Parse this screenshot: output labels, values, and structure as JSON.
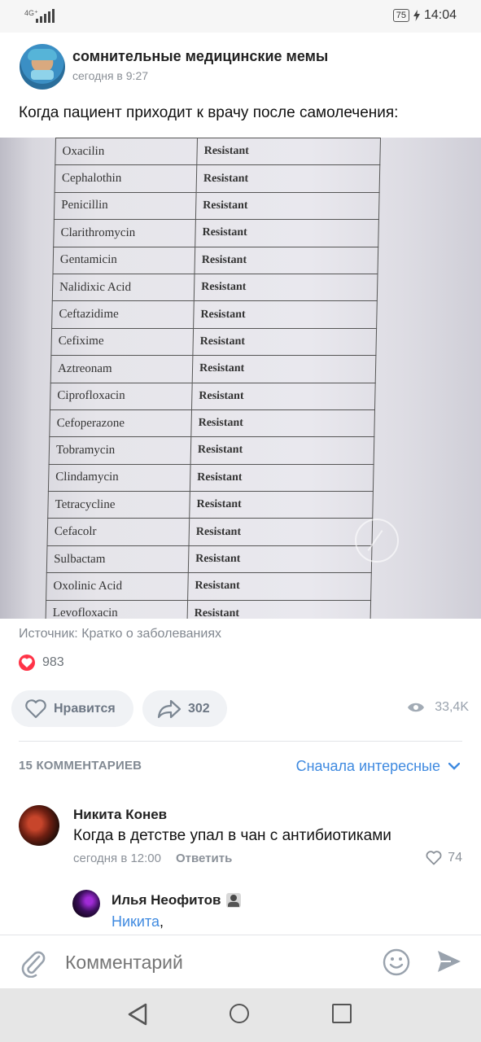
{
  "status": {
    "network": "4G⁺",
    "battery": "75",
    "time": "14:04"
  },
  "post": {
    "group_name": "сомнительные медицинские мемы",
    "time": "сегодня в 9:27",
    "text": "Когда пациент приходит к врачу после самолечения:",
    "photo_table": [
      {
        "drug": "Oxacilin",
        "result": "Resistant"
      },
      {
        "drug": "Cephalothin",
        "result": "Resistant"
      },
      {
        "drug": "Penicillin",
        "result": "Resistant"
      },
      {
        "drug": "Clarithromycin",
        "result": "Resistant"
      },
      {
        "drug": "Gentamicin",
        "result": "Resistant"
      },
      {
        "drug": "Nalidixic Acid",
        "result": "Resistant"
      },
      {
        "drug": "Ceftazidime",
        "result": "Resistant"
      },
      {
        "drug": "Cefixime",
        "result": "Resistant"
      },
      {
        "drug": "Aztreonam",
        "result": "Resistant"
      },
      {
        "drug": "Ciprofloxacin",
        "result": "Resistant"
      },
      {
        "drug": "Cefoperazone",
        "result": "Resistant"
      },
      {
        "drug": "Tobramycin",
        "result": "Resistant"
      },
      {
        "drug": "Clindamycin",
        "result": "Resistant"
      },
      {
        "drug": "Tetracycline",
        "result": "Resistant"
      },
      {
        "drug": "Cefacolr",
        "result": "Resistant"
      },
      {
        "drug": "Sulbactam",
        "result": "Resistant"
      },
      {
        "drug": "Oxolinic Acid",
        "result": "Resistant"
      },
      {
        "drug": "Levofloxacin",
        "result": "Resistant"
      }
    ],
    "source": "Источник: Кратко о заболеваниях",
    "likes": "983",
    "like_label": "Нравится",
    "shares": "302",
    "views": "33,4K"
  },
  "comments": {
    "count_label": "15 КОММЕНТАРИЕВ",
    "sort_label": "Сначала интересные",
    "items": [
      {
        "author": "Никита Конев",
        "text": "Когда в детстве упал в чан с антибиотиками",
        "time": "сегодня в 12:00",
        "reply_label": "Ответить",
        "likes": "74"
      }
    ],
    "reply": {
      "author": "Илья Неофитов",
      "mention": "Никита",
      "suffix": ","
    }
  },
  "composer": {
    "placeholder": "Комментарий"
  },
  "colors": {
    "accent": "#3f8ae0",
    "like_red": "#ff3347"
  },
  "icons": [
    "attach-icon",
    "emoji-icon",
    "send-icon",
    "heart-icon",
    "share-icon",
    "eye-icon",
    "chevron-down-icon",
    "back-icon",
    "home-icon",
    "recents-icon"
  ]
}
